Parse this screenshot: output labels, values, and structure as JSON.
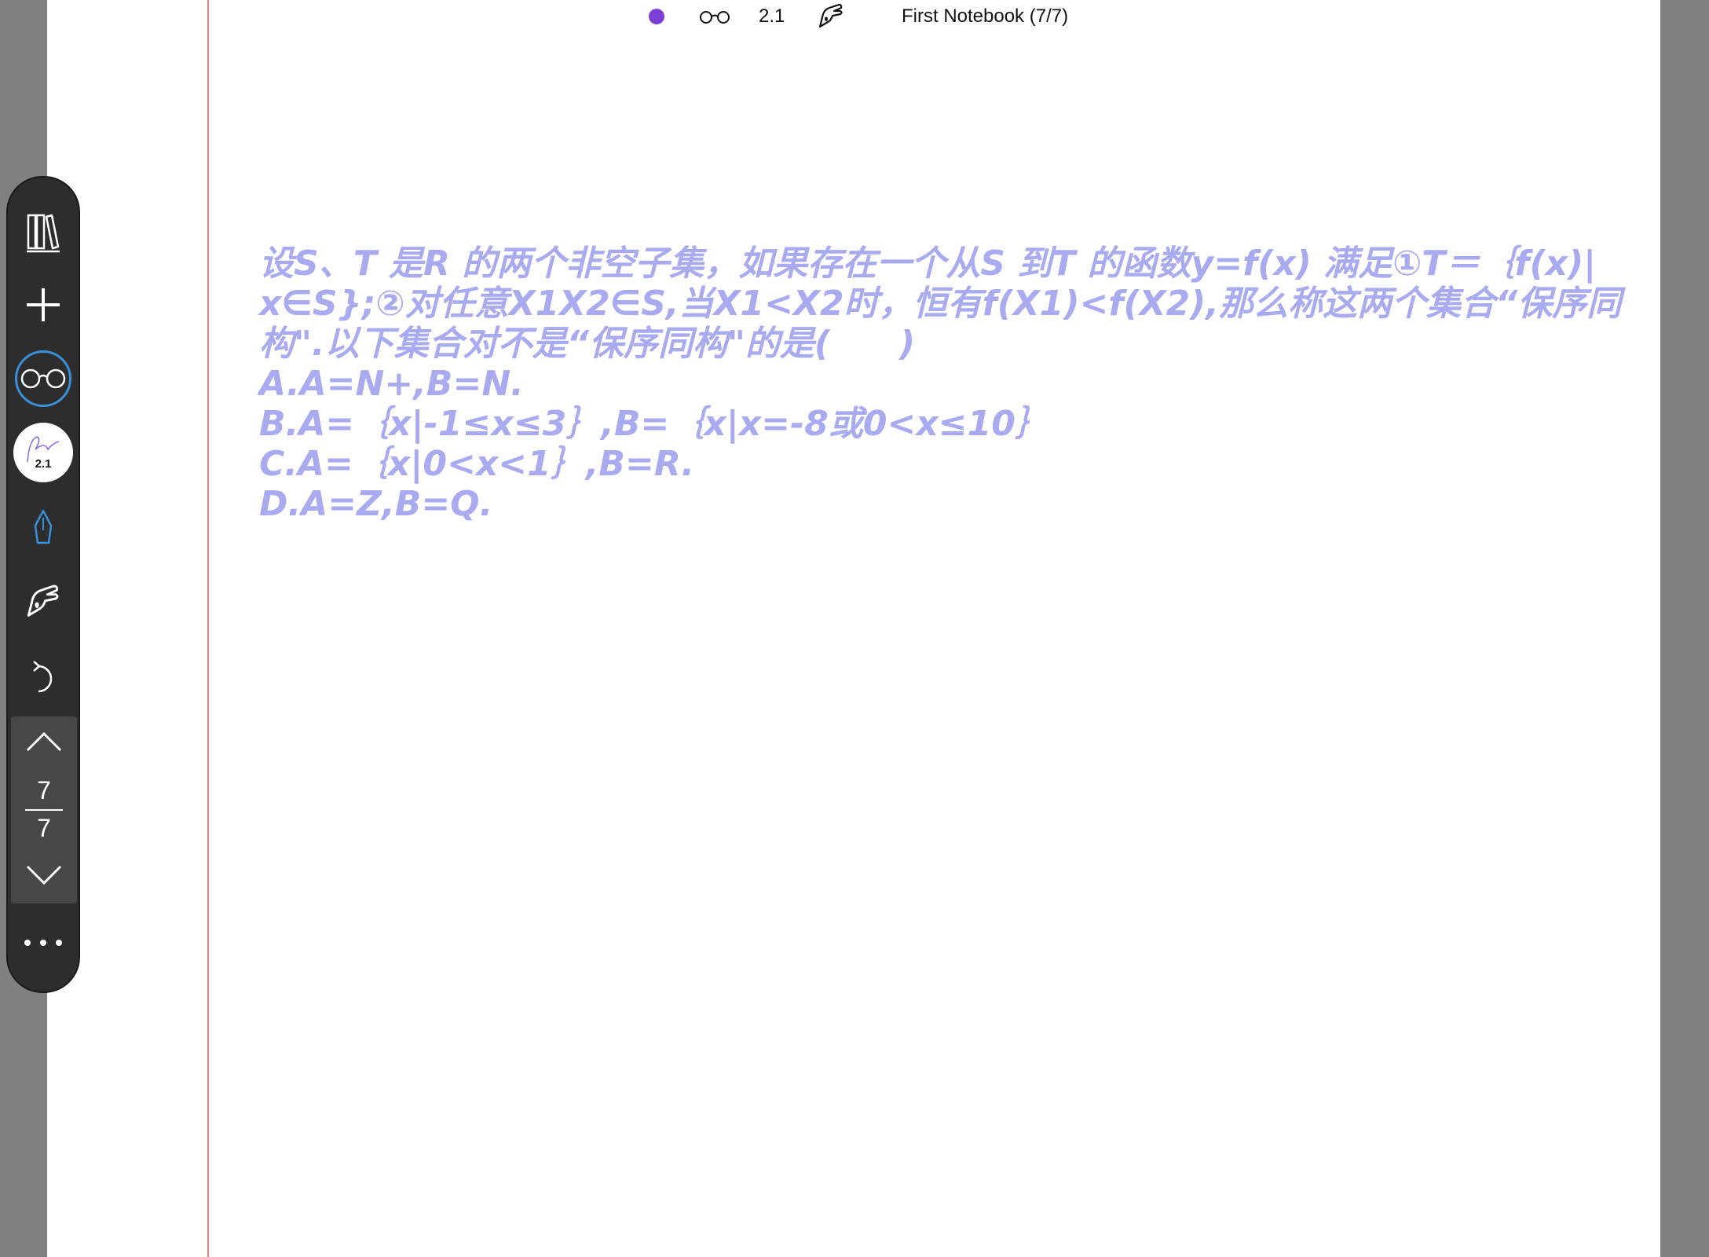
{
  "status_bar": {
    "pen_size": "2.1",
    "notebook_title": "First Notebook (7/7)",
    "pen_color": "#7b3fd6",
    "icons": [
      "pen-color-dot",
      "glasses-icon",
      "hand-draw-icon"
    ]
  },
  "question": {
    "lines": [
      "设S、T 是R 的两个非空子集，如果存在一个从S 到T 的函数y=f(x) 满足①T＝｛f(x)|",
      "x∈S};②对任意X1X2∈S,当X1<X2时，恒有f(X1)<f(X2),那么称这两个集合“保序同",
      "构\".以下集合对不是“保序同构\"的是(　　)",
      "A.A=N+,B=N.",
      "B.A=｛x|-1≤x≤3｝,B=｛x|x=-8或0<x≤10｝",
      "C.A=｛x|0<x<1｝,B=R.",
      "D.A=Z,B=Q."
    ],
    "color": "#a9aaf0"
  },
  "toolbar": {
    "items": [
      "library-icon",
      "add-icon",
      "glasses-icon",
      "pen-settings",
      "pen-tool-icon",
      "hand-draw-icon",
      "undo-icon",
      "page-up-icon",
      "page-down-icon",
      "more-icon"
    ],
    "pen_size": "2.1",
    "page_current": "7",
    "page_total": "7",
    "accent": "#3a8fd9"
  }
}
